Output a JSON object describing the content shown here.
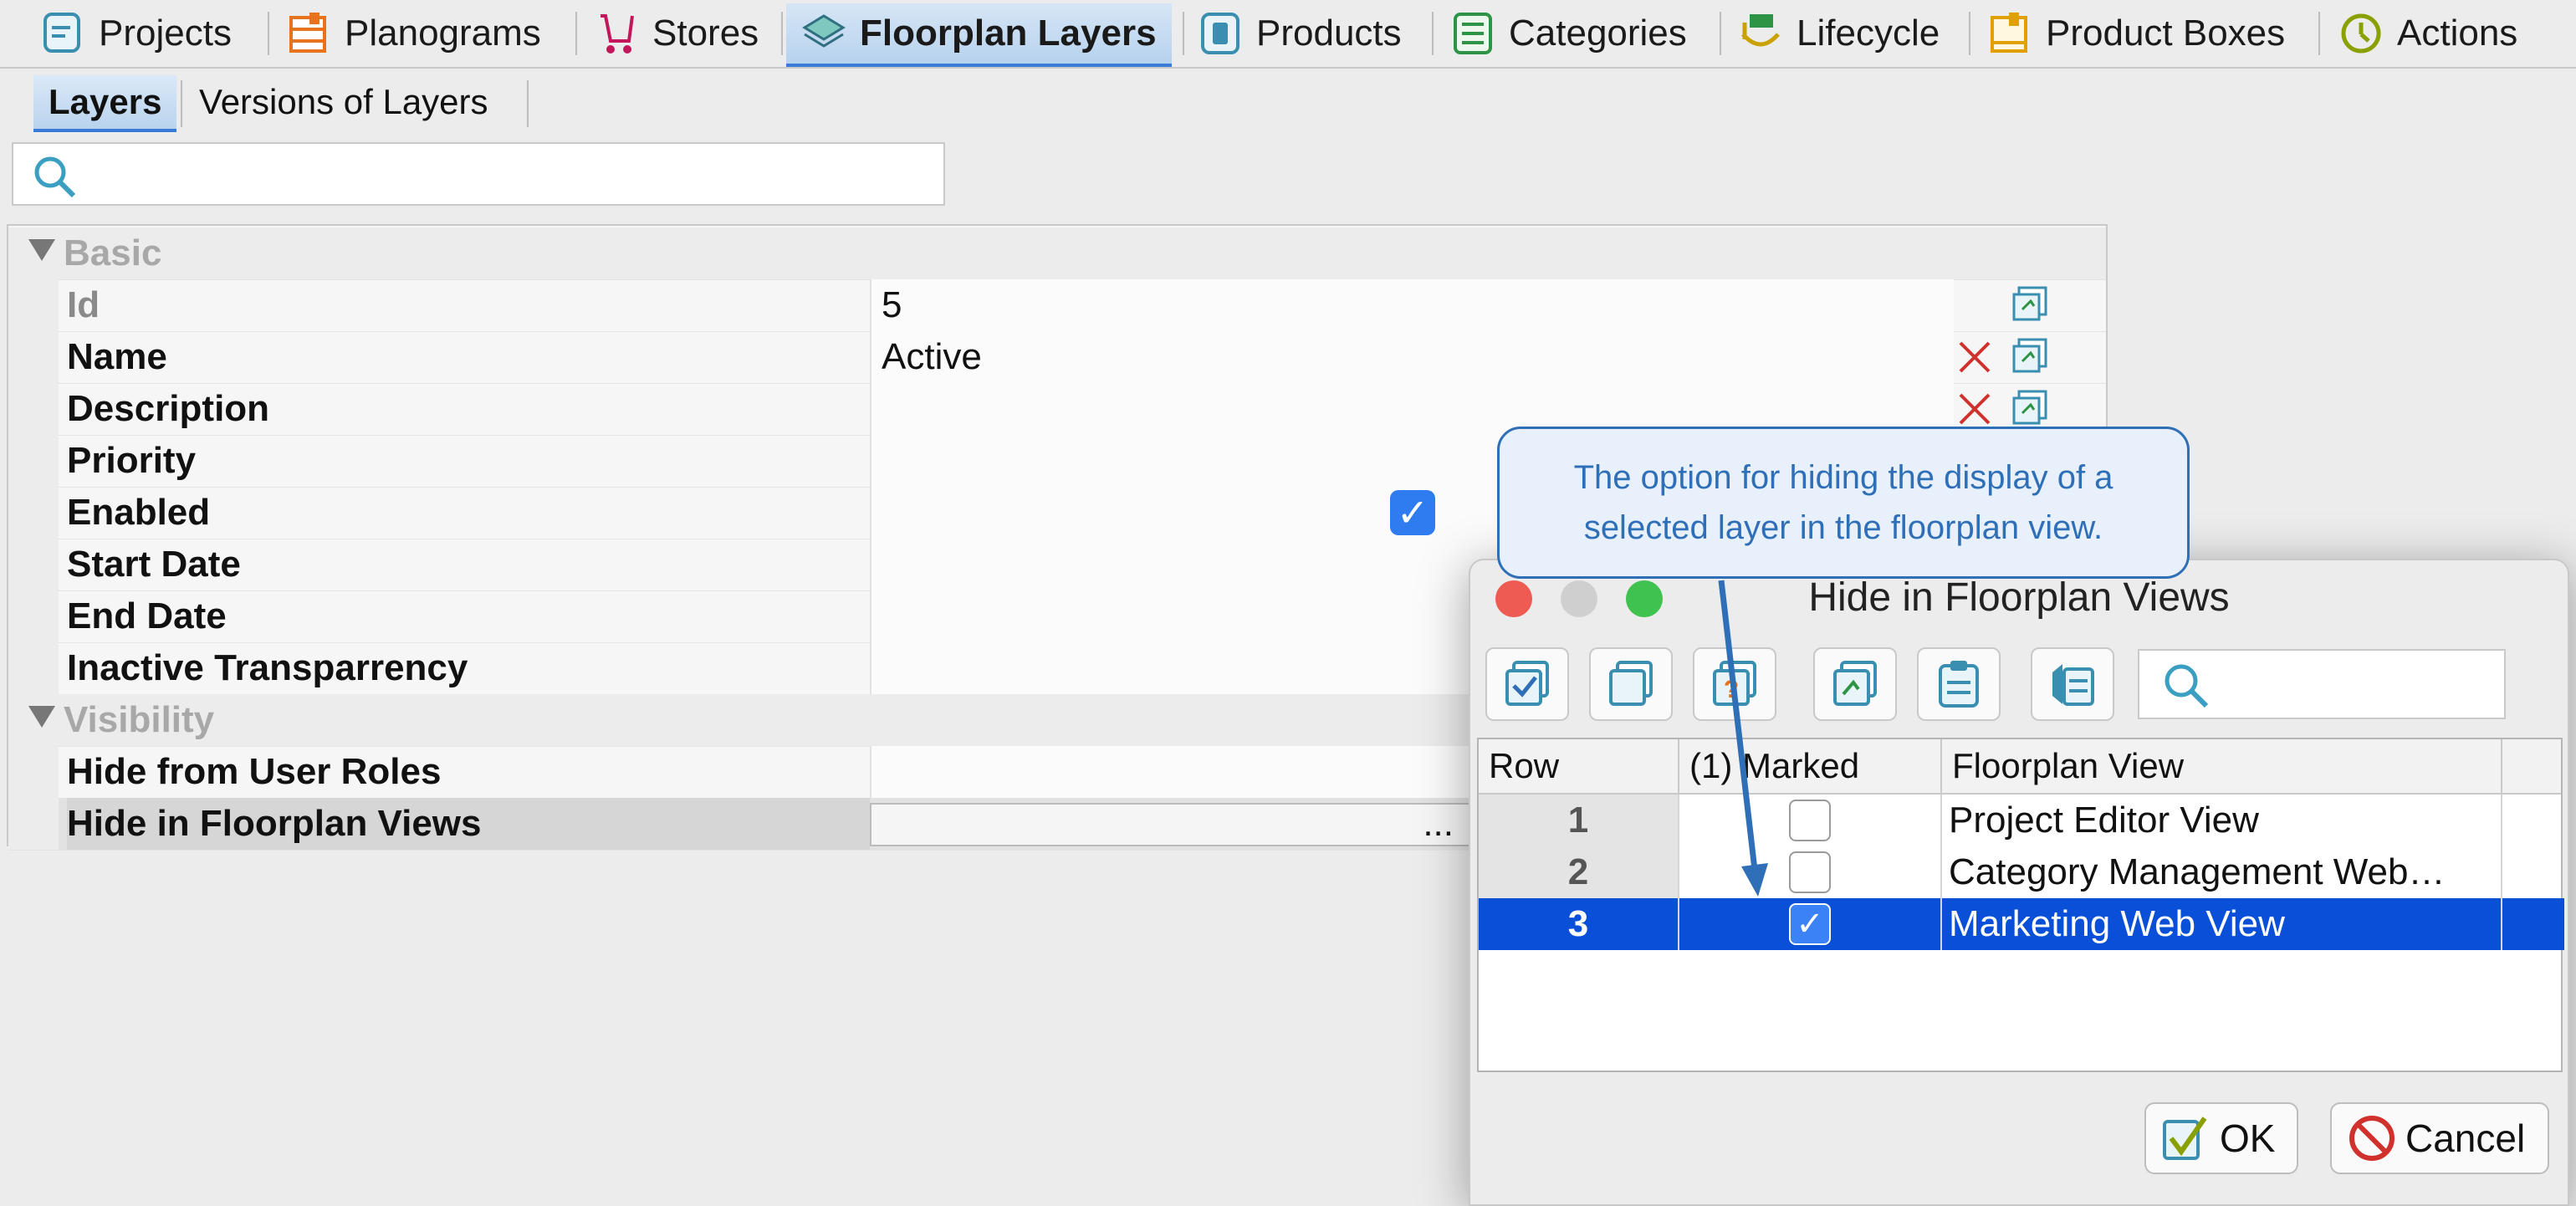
{
  "tabs": [
    {
      "label": "Projects",
      "icon": "projects-icon"
    },
    {
      "label": "Planograms",
      "icon": "planograms-icon"
    },
    {
      "label": "Stores",
      "icon": "stores-cart-icon"
    },
    {
      "label": "Floorplan Layers",
      "icon": "layers-icon",
      "active": true
    },
    {
      "label": "Products",
      "icon": "products-icon"
    },
    {
      "label": "Categories",
      "icon": "categories-icon"
    },
    {
      "label": "Lifecycle",
      "icon": "lifecycle-icon"
    },
    {
      "label": "Product Boxes",
      "icon": "product-boxes-icon"
    },
    {
      "label": "Actions",
      "icon": "actions-icon"
    }
  ],
  "subtabs": [
    {
      "label": "Layers",
      "active": true
    },
    {
      "label": "Versions of Layers"
    }
  ],
  "search": {
    "placeholder": ""
  },
  "groups": {
    "basic": {
      "label": "Basic",
      "rows": [
        {
          "label": "Id",
          "value": "5"
        },
        {
          "label": "Name",
          "value": "Active"
        },
        {
          "label": "Description",
          "value": ""
        },
        {
          "label": "Priority",
          "value": ""
        },
        {
          "label": "Enabled",
          "value": "",
          "checked": true
        },
        {
          "label": "Start Date",
          "value": ""
        },
        {
          "label": "End Date",
          "value": ""
        },
        {
          "label": "Inactive Transparrency",
          "value": ""
        }
      ]
    },
    "visibility": {
      "label": "Visibility",
      "rows": [
        {
          "label": "Hide from User Roles",
          "value": ""
        },
        {
          "label": "Hide in Floorplan Views",
          "value": "..."
        }
      ]
    }
  },
  "callout": {
    "text": "The option for hiding the display of a selected layer in the floorplan view."
  },
  "dialog": {
    "title": "Hide in Floorplan Views",
    "toolbar": [
      "check-all-icon",
      "uncheck-all-icon",
      "invert-check-icon",
      "copy-marked-icon",
      "clipboard-icon",
      "paste-list-icon"
    ],
    "columns": [
      "Row",
      "(1) Marked",
      "Floorplan View"
    ],
    "rows": [
      {
        "num": "1",
        "marked": false,
        "view": "Project Editor View"
      },
      {
        "num": "2",
        "marked": false,
        "view": "Category Management Web…"
      },
      {
        "num": "3",
        "marked": true,
        "view": "Marketing Web View",
        "selected": true
      }
    ],
    "ok_label": "OK",
    "cancel_label": "Cancel"
  },
  "colors": {
    "accent": "#3a7bd5",
    "selection": "#0a4fd8",
    "callout_border": "#2e6fb7",
    "delete": "#d0312d"
  }
}
